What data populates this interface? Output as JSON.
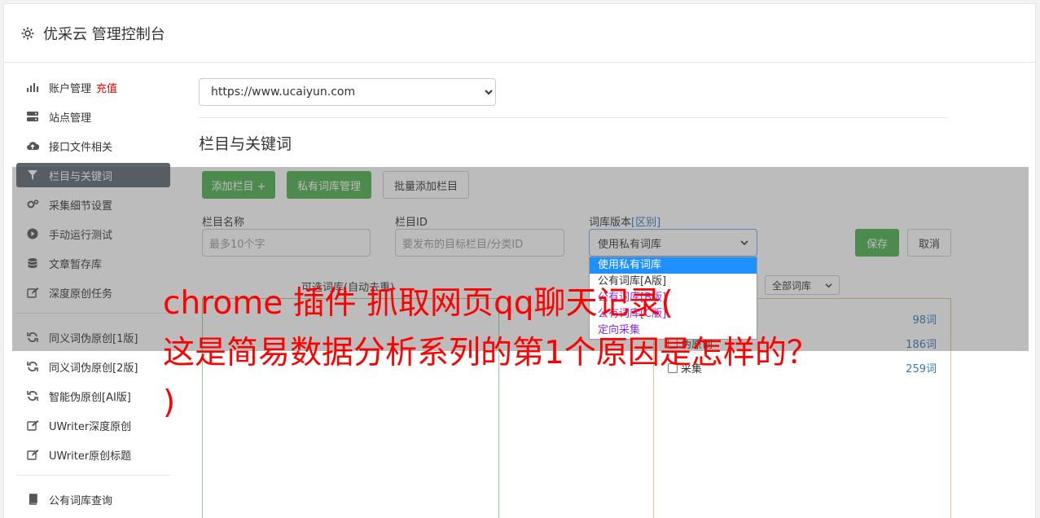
{
  "header": {
    "title": "优采云 管理控制台"
  },
  "sidebar": {
    "group1": [
      {
        "name": "sidebar-item-account",
        "icon": "bar-chart-icon",
        "label": "账户管理",
        "badge": "充值"
      },
      {
        "name": "sidebar-item-sites",
        "icon": "server-icon",
        "label": "站点管理"
      },
      {
        "name": "sidebar-item-interface-files",
        "icon": "cloud-upload-icon",
        "label": "接口文件相关"
      },
      {
        "name": "sidebar-item-columns-keywords",
        "icon": "filter-icon",
        "label": "栏目与关键词",
        "active": true
      },
      {
        "name": "sidebar-item-collect-settings",
        "icon": "gears-icon",
        "label": "采集细节设置"
      },
      {
        "name": "sidebar-item-manual-run",
        "icon": "play-circle-icon",
        "label": "手动运行测试"
      },
      {
        "name": "sidebar-item-article-storage",
        "icon": "database-icon",
        "label": "文章暂存库"
      },
      {
        "name": "sidebar-item-deep-original",
        "icon": "edit-icon",
        "label": "深度原创任务"
      }
    ],
    "group2": [
      {
        "name": "sidebar-item-synonym-1",
        "icon": "refresh-icon",
        "label": "同义词伪原创[1版]"
      },
      {
        "name": "sidebar-item-synonym-2",
        "icon": "refresh-icon",
        "label": "同义词伪原创[2版]"
      },
      {
        "name": "sidebar-item-ai-original",
        "icon": "refresh-icon",
        "label": "智能伪原创[AI版]"
      },
      {
        "name": "sidebar-item-uwriter-deep",
        "icon": "edit-icon",
        "label": "UWriter深度原创"
      },
      {
        "name": "sidebar-item-uwriter-title",
        "icon": "edit-icon",
        "label": "UWriter原创标题"
      }
    ],
    "group3": [
      {
        "name": "sidebar-item-public-lexicon",
        "icon": "book-icon",
        "label": "公有词库查询"
      }
    ]
  },
  "main": {
    "site_select": "https://www.ucaiyun.com",
    "section_title": "栏目与关键词",
    "buttons": {
      "add_column": "添加栏目 +",
      "private_lexicon": "私有词库管理",
      "batch_add": "批量添加栏目",
      "save": "保存",
      "cancel": "取消"
    },
    "form": {
      "column_name_label": "栏目名称",
      "column_name_placeholder": "最多10个字",
      "column_id_label": "栏目ID",
      "column_id_placeholder": "要发布的目标栏目/分类ID",
      "lexicon_label": "词库版本",
      "lexicon_diff": "[区别]",
      "lexicon_value": "使用私有词库",
      "lexicon_options": [
        "使用私有词库",
        "公有词库[A版]",
        "公有词库[B版]",
        "公有词库[C版]",
        "定向采集"
      ]
    },
    "left_panel_title": "可选词库(自动去重)",
    "lexicon_filter": "全部词库",
    "right_rows": [
      {
        "name": "",
        "count": "98词"
      },
      {
        "name": "伪原创",
        "count": "186词"
      },
      {
        "name": "采集",
        "count": "259词"
      }
    ]
  },
  "watermark": {
    "line1": "chrome 插件 抓取网页qq聊天记录(",
    "line2": "这是简易数据分析系列的第1个原因是怎样的？",
    "line3": ")"
  }
}
